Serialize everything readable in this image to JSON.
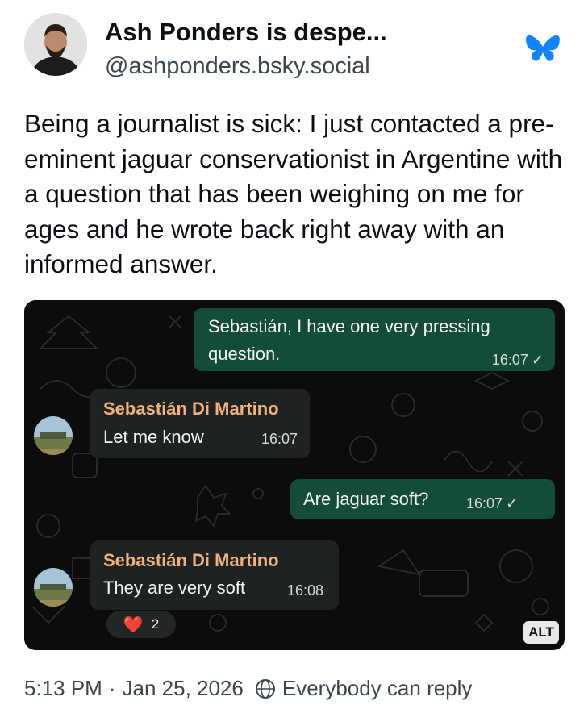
{
  "post": {
    "author_name": "Ash Ponders is despe...",
    "handle": "@ashponders.bsky.social",
    "text": "Being a journalist is sick: I just contacted a pre-eminent jaguar conservationist in Argentine with a question that has been weighing on me for ages and he wrote back right away with an informed answer.",
    "logo_icon": "butterfly-icon"
  },
  "chat": {
    "messages": [
      {
        "direction": "outgoing",
        "line1": "Sebastián, I have one very pressing",
        "line2": "question.",
        "time": "16:07",
        "status": "✓"
      },
      {
        "direction": "incoming",
        "sender": "Sebastián Di Martino",
        "text": "Let me know",
        "time": "16:07"
      },
      {
        "direction": "outgoing",
        "text": "Are jaguar soft?",
        "time": "16:07",
        "status": "✓"
      },
      {
        "direction": "incoming",
        "sender": "Sebastián Di Martino",
        "text": "They are very soft",
        "time": "16:08"
      }
    ],
    "reaction": {
      "emoji": "❤️",
      "count": "2"
    },
    "alt_badge": "ALT",
    "colors": {
      "outgoing_bubble": "#134d37",
      "incoming_bubble": "#1f2223",
      "sender_name": "#f0b27a"
    }
  },
  "footer": {
    "time": "5:13 PM",
    "separator": "·",
    "date": "Jan 25, 2026",
    "reply_setting": "Everybody can reply",
    "reply_icon": "globe-icon"
  },
  "colors": {
    "brand": "#1185fe",
    "text": "#0b0f14",
    "muted": "#3d4650"
  }
}
